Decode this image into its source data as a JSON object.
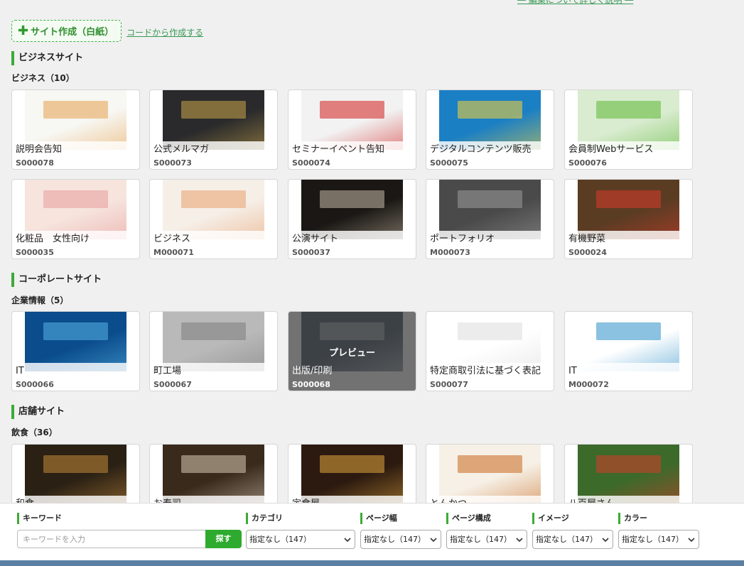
{
  "top_link": "― 編集について詳しく説明 ―",
  "create": {
    "blank_label": "サイト作成（白紙）",
    "code_link": "コードから作成する"
  },
  "sections": [
    {
      "title": "ビジネスサイト",
      "category": "ビジネス（10）"
    },
    {
      "title": "コーポレートサイト",
      "category": "企業情報（5）"
    },
    {
      "title": "店舗サイト",
      "category": "飲食（36）"
    }
  ],
  "business_cards": [
    {
      "name": "説明会告知",
      "code": "S000078",
      "colors": [
        "#f7f7f3",
        "#e8a14c"
      ]
    },
    {
      "name": "公式メルマガ",
      "code": "S000073",
      "colors": [
        "#2a2a2c",
        "#c9a64a"
      ]
    },
    {
      "name": "セミナーイベント告知",
      "code": "S000074",
      "colors": [
        "#f2f2f2",
        "#d11f1f"
      ]
    },
    {
      "name": "デジタルコンテンツ販売",
      "code": "S000075",
      "colors": [
        "#1b7fc4",
        "#fcd534"
      ]
    },
    {
      "name": "会員制Webサービス",
      "code": "S000076",
      "colors": [
        "#d9ecd0",
        "#5cb833"
      ]
    },
    {
      "name": "化粧品　女性向け",
      "code": "S000035",
      "colors": [
        "#f6e4dd",
        "#e89a9a"
      ]
    },
    {
      "name": "ビジネス",
      "code": "M000071",
      "colors": [
        "#f6efe8",
        "#e7a06e"
      ]
    },
    {
      "name": "公演サイト",
      "code": "S000037",
      "colors": [
        "#1a1714",
        "#c7b9a5"
      ]
    },
    {
      "name": "ポートフォリオ",
      "code": "M000073",
      "colors": [
        "#4a4a4a",
        "#9c9c9c"
      ]
    },
    {
      "name": "有機野菜",
      "code": "S000024",
      "colors": [
        "#5a3c23",
        "#d83a2a"
      ]
    }
  ],
  "corporate_cards": [
    {
      "name": "IT",
      "code": "S000066",
      "colors": [
        "#0a4c8c",
        "#58b5e6"
      ]
    },
    {
      "name": "町工場",
      "code": "S000067",
      "colors": [
        "#b9b9b9",
        "#7e7e7e"
      ]
    },
    {
      "name": "出版/印刷",
      "code": "S000068",
      "colors": [
        "#3e4f60",
        "#d2d8de"
      ],
      "hover_text": "プレビュー"
    },
    {
      "name": "特定商取引法に基づく表記",
      "code": "S000077",
      "colors": [
        "#ffffff",
        "#dddddd"
      ]
    },
    {
      "name": "IT",
      "code": "M000072",
      "colors": [
        "#ffffff",
        "#2c8fc8"
      ]
    }
  ],
  "store_cards": [
    {
      "name": "和食",
      "code": "",
      "colors": [
        "#2a2014",
        "#c28a3a"
      ]
    },
    {
      "name": "お寿司",
      "code": "",
      "colors": [
        "#3a2a1c",
        "#d7c7b3"
      ]
    },
    {
      "name": "定食屋",
      "code": "",
      "colors": [
        "#2c1a10",
        "#e0a53a"
      ]
    },
    {
      "name": "とんかつ",
      "code": "",
      "colors": [
        "#f6f0e6",
        "#c8691e"
      ]
    },
    {
      "name": "八百屋さん",
      "code": "",
      "colors": [
        "#3c6a2a",
        "#d63a2a"
      ]
    }
  ],
  "filters": {
    "keyword": {
      "label": "キーワード",
      "placeholder": "キーワードを入力",
      "button": "探す"
    },
    "category": {
      "label": "カテゴリ",
      "value": "指定なし（147）"
    },
    "page_width": {
      "label": "ページ幅",
      "value": "指定なし（147）"
    },
    "page_structure": {
      "label": "ページ構成",
      "value": "指定なし（147）"
    },
    "image": {
      "label": "イメージ",
      "value": "指定なし（147）"
    },
    "color": {
      "label": "カラー",
      "value": "指定なし（147）"
    }
  },
  "accent_color": "#3cab36"
}
